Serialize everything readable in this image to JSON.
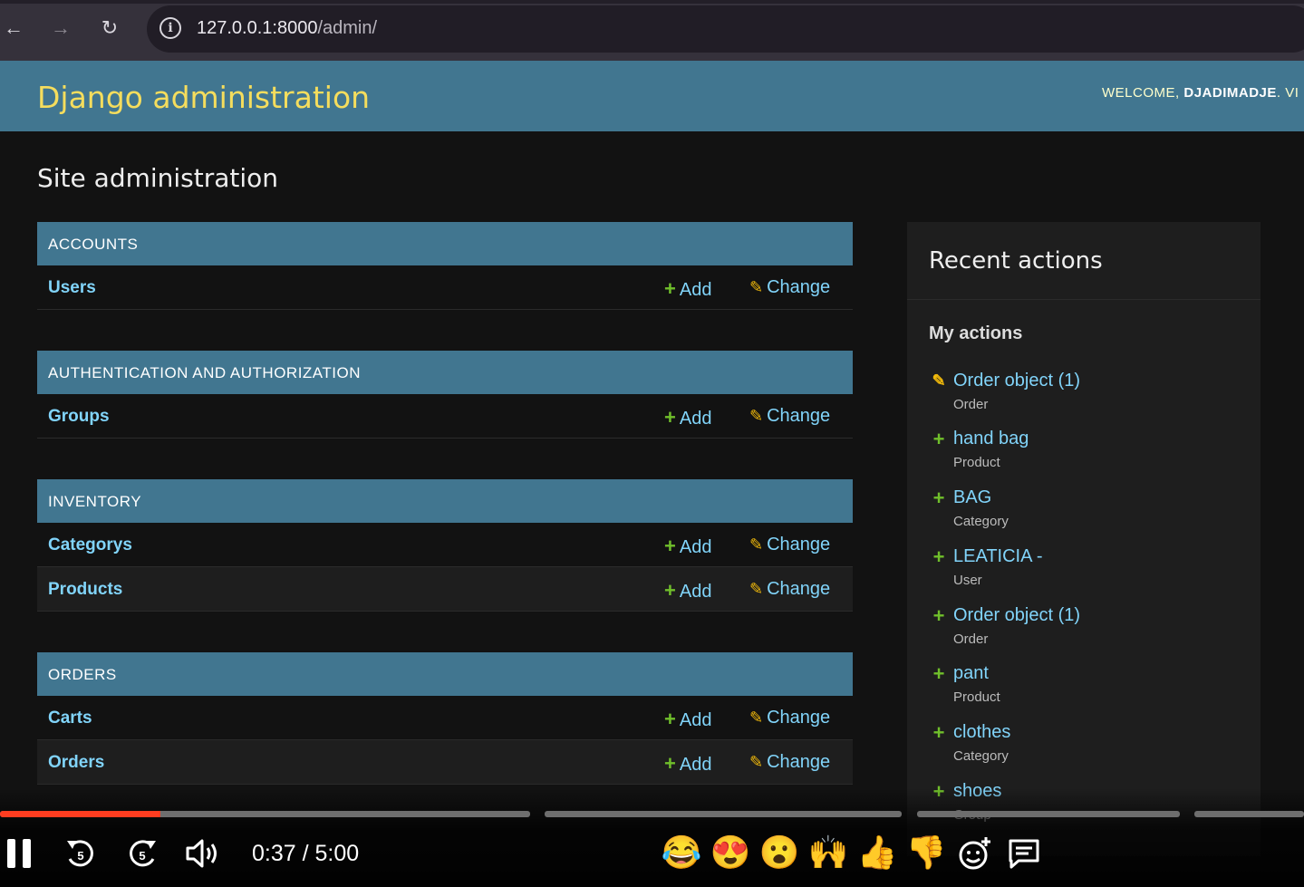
{
  "browser": {
    "back_glyph": "←",
    "forward_glyph": "→",
    "reload_glyph": "↻",
    "info_glyph": "i",
    "url_host": "127.0.0.1:8000",
    "url_path": "/admin/"
  },
  "header": {
    "brand": "Django administration",
    "welcome": "WELCOME,",
    "username": "DJADIMADJE",
    "tail": ". VI"
  },
  "page_title": "Site administration",
  "add_label": "Add",
  "change_label": "Change",
  "modules": {
    "accounts": {
      "caption": "ACCOUNTS",
      "models": [
        "Users"
      ]
    },
    "auth": {
      "caption": "AUTHENTICATION AND AUTHORIZATION",
      "models": [
        "Groups"
      ]
    },
    "inventory": {
      "caption": "INVENTORY",
      "models": [
        "Categorys",
        "Products"
      ]
    },
    "orders": {
      "caption": "ORDERS",
      "models": [
        "Carts",
        "Orders"
      ]
    }
  },
  "recent": {
    "title": "Recent actions",
    "subtitle": "My actions",
    "items": [
      {
        "icon": "pencil-icon",
        "title": "Order object (1)",
        "type": "Order"
      },
      {
        "icon": "plus-icon",
        "title": "hand bag",
        "type": "Product"
      },
      {
        "icon": "plus-icon",
        "title": "BAG",
        "type": "Category"
      },
      {
        "icon": "plus-icon",
        "title": "LEATICIA -",
        "type": "User"
      },
      {
        "icon": "plus-icon",
        "title": "Order object (1)",
        "type": "Order"
      },
      {
        "icon": "plus-icon",
        "title": "pant",
        "type": "Product"
      },
      {
        "icon": "plus-icon",
        "title": "clothes",
        "type": "Category"
      },
      {
        "icon": "plus-icon",
        "title": "shoes",
        "type": "Group"
      }
    ]
  },
  "player": {
    "time": "0:37 / 5:00",
    "played_fraction": 0.123,
    "icons": [
      "pause-icon",
      "rewind-5-icon",
      "forward-5-icon",
      "volume-icon"
    ],
    "reactions": [
      "😂",
      "😍",
      "😮",
      "🙌",
      "👍",
      "👎"
    ],
    "reaction_names": [
      "laugh-reaction",
      "love-reaction",
      "wow-reaction",
      "celebrate-reaction",
      "thumbs-up-reaction",
      "thumbs-down-reaction"
    ],
    "add_reaction_glyph": "☺",
    "comments_glyph": "☰"
  },
  "colors": {
    "header_bg": "#417690",
    "brand": "#f5dd5d",
    "link": "#81d4fa",
    "add_plus": "#70bf2b",
    "change_pencil": "#efb80b",
    "progress_played": "#ff3d20"
  }
}
